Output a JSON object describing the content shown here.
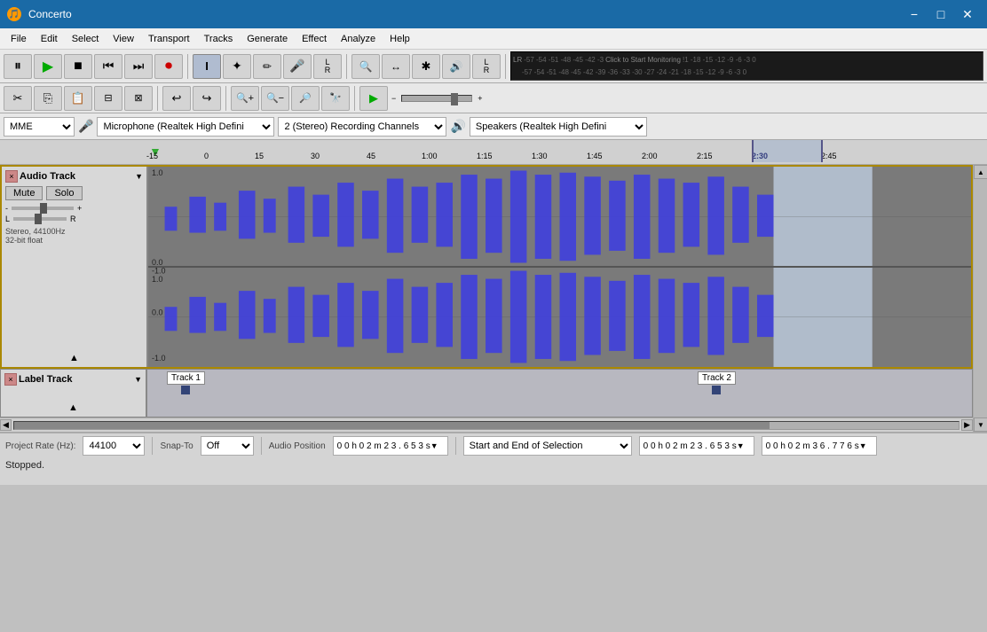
{
  "app": {
    "title": "Concerto",
    "icon": "🎵"
  },
  "titlebar": {
    "title": "Concerto",
    "minimize_label": "−",
    "maximize_label": "□",
    "close_label": "✕"
  },
  "menu": {
    "items": [
      "File",
      "Edit",
      "Select",
      "View",
      "Transport",
      "Tracks",
      "Generate",
      "Effect",
      "Analyze",
      "Help"
    ]
  },
  "toolbar": {
    "transport": {
      "pause": "⏸",
      "play": "▶",
      "stop": "■",
      "skip_start": "⏮",
      "skip_end": "⏭",
      "record": "⏺"
    },
    "tools": {
      "select": "I",
      "envelope": "∿",
      "pencil": "✏",
      "mic": "🎤",
      "lr_label": "L\nR",
      "zoom_in": "🔍+",
      "time_shift": "↔",
      "multi": "✱",
      "vol_lr": "🔊\nLR"
    }
  },
  "vu_meters": {
    "top_scale": "-57 -54 -51 -48 -45 -42 -3 Click to Start Monitoring !1 -18 -15 -12 -9 -6 -3 0",
    "bot_scale": "-57 -54 -51 -48 -45 -42 -39 -36 -33 -30 -27 -24 -21 -18 -15 -12 -9 -6 -3 0"
  },
  "devices": {
    "audio_host": "MME",
    "mic_device": "Microphone (Realtek High Defini",
    "recording_channels": "2 (Stereo) Recording Channels",
    "output_device": "Speakers (Realtek High Defini"
  },
  "timeline": {
    "marks": [
      "-15",
      "0",
      "15",
      "30",
      "45",
      "1:00",
      "1:15",
      "1:30",
      "1:45",
      "2:00",
      "2:15",
      "2:30",
      "2:45"
    ],
    "playhead_position": "2:30",
    "selection_start": "2:30"
  },
  "tracks": {
    "audio_track": {
      "name": "Audio Track",
      "close": "×",
      "dropdown": "▼",
      "mute": "Mute",
      "solo": "Solo",
      "gain_min": "-",
      "gain_max": "+",
      "pan_l": "L",
      "pan_r": "R",
      "info": "Stereo, 44100Hz\n32-bit float",
      "collapse": "▲",
      "scale_top": "1.0",
      "scale_mid": "0.0",
      "scale_bot": "-1.0",
      "scale_top2": "1.0",
      "scale_mid2": "0.0",
      "scale_bot2": "-1.0"
    },
    "label_track": {
      "name": "Label Track",
      "close": "×",
      "dropdown": "▼",
      "collapse": "▲",
      "label1": "Track 1",
      "label2": "Track 2"
    }
  },
  "status": {
    "project_rate_label": "Project Rate (Hz):",
    "project_rate_value": "44100",
    "snap_to_label": "Snap-To",
    "snap_to_value": "Off",
    "audio_position_label": "Audio Position",
    "audio_position_value": "0 0 h 0 2 m 2 3 . 6 5 3 s",
    "selection_label": "Start and End of Selection",
    "selection_start_value": "0 0 h 0 2 m 2 3 . 6 5 3 s",
    "selection_end_value": "0 0 h 0 2 m 3 6 . 7 7 6 s",
    "status_text": "Stopped."
  },
  "colors": {
    "title_bg": "#1a6aa6",
    "waveform_bg": "#888888",
    "waveform_color": "#4444cc",
    "selection_bg": "#dde8f5",
    "track_header_bg": "#d8d8d8",
    "ruler_bg": "#d0d0d0"
  }
}
